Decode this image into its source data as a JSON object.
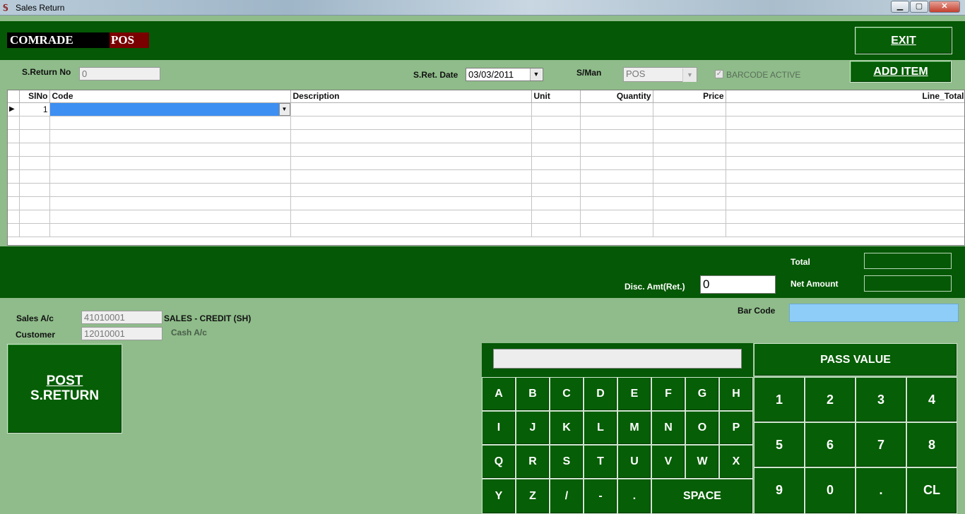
{
  "window": {
    "title": "Sales Return",
    "icon": "app-icon",
    "controls": {
      "minimize": "▁",
      "maximize": "▢",
      "close": "✕"
    }
  },
  "brand": {
    "left": "COMRADE",
    "right": "POS"
  },
  "buttons": {
    "exit": "EXIT",
    "add_item": "ADD ITEM",
    "post_line1": "POST",
    "post_line2": "S.RETURN",
    "pass_value": "PASS VALUE"
  },
  "form": {
    "return_no_label": "S.Return No",
    "return_no": "0",
    "date_label": "S.Ret. Date",
    "date": "03/03/2011",
    "sman_label": "S/Man",
    "sman": "POS",
    "barcode_active_label": "BARCODE ACTIVE",
    "barcode_active_checked": true
  },
  "grid": {
    "columns": [
      "SlNo",
      "Code",
      "Description",
      "Unit",
      "Quantity",
      "Price",
      "Line_Total"
    ],
    "rows": [
      {
        "slno": "1",
        "code": "",
        "description": "",
        "unit": "",
        "quantity": "",
        "price": "",
        "line_total": ""
      }
    ]
  },
  "totals": {
    "total_label": "Total",
    "total": "",
    "net_label": "Net Amount",
    "net": "",
    "disc_label": "Disc. Amt(Ret.)",
    "disc": "0"
  },
  "bottom": {
    "barcode_label": "Bar Code",
    "barcode": "",
    "sales_ac_label": "Sales A/c",
    "sales_ac": "41010001",
    "sales_ac_name": "SALES - CREDIT (SH)",
    "customer_label": "Customer",
    "customer": "12010001",
    "customer_name": "Cash A/c"
  },
  "keypad": {
    "display": "",
    "letters": [
      "A",
      "B",
      "C",
      "D",
      "E",
      "F",
      "G",
      "H",
      "I",
      "J",
      "K",
      "L",
      "M",
      "N",
      "O",
      "P",
      "Q",
      "R",
      "S",
      "T",
      "U",
      "V",
      "W",
      "X",
      "Y",
      "Z",
      "/",
      "-",
      "."
    ],
    "space": "SPACE",
    "numbers": [
      "1",
      "2",
      "3",
      "4",
      "5",
      "6",
      "7",
      "8",
      "9",
      "0",
      ".",
      "CL"
    ]
  },
  "colors": {
    "background": "#8fbc8a",
    "band": "#055805",
    "selection": "#3d8ff2",
    "barcode_field": "#8ecdf7"
  }
}
